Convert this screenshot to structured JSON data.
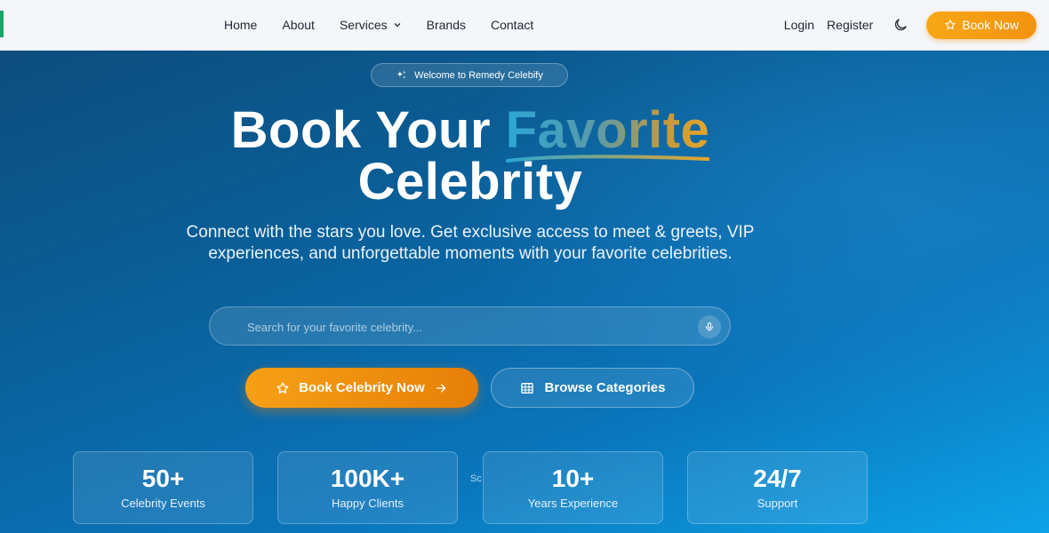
{
  "nav": {
    "links": [
      {
        "label": "Home"
      },
      {
        "label": "About"
      },
      {
        "label": "Services"
      },
      {
        "label": "Brands"
      },
      {
        "label": "Contact"
      }
    ],
    "login": "Login",
    "register": "Register",
    "book_now": "Book Now"
  },
  "hero": {
    "badge": "Welcome to Remedy Celebify",
    "title_part1": "Book Your ",
    "title_highlight": "Favorite",
    "title_line2": "Celebrity",
    "subtitle": "Connect with the stars you love. Get exclusive access to meet & greets, VIP experiences, and unforgettable moments with your favorite celebrities.",
    "search_placeholder": "Search for your favorite celebrity...",
    "primary_button": "Book Celebrity Now",
    "secondary_button": "Browse Categories"
  },
  "stats": [
    {
      "value": "50+",
      "label": "Celebrity Events"
    },
    {
      "value": "100K+",
      "label": "Happy Clients"
    },
    {
      "value": "10+",
      "label": "Years Experience"
    },
    {
      "value": "24/7",
      "label": "Support"
    }
  ],
  "stray_text": "Sc",
  "colors": {
    "accent_orange": "#f39311",
    "nav_bg": "#f4f6f9",
    "hero_blue": "#0a5d95"
  }
}
